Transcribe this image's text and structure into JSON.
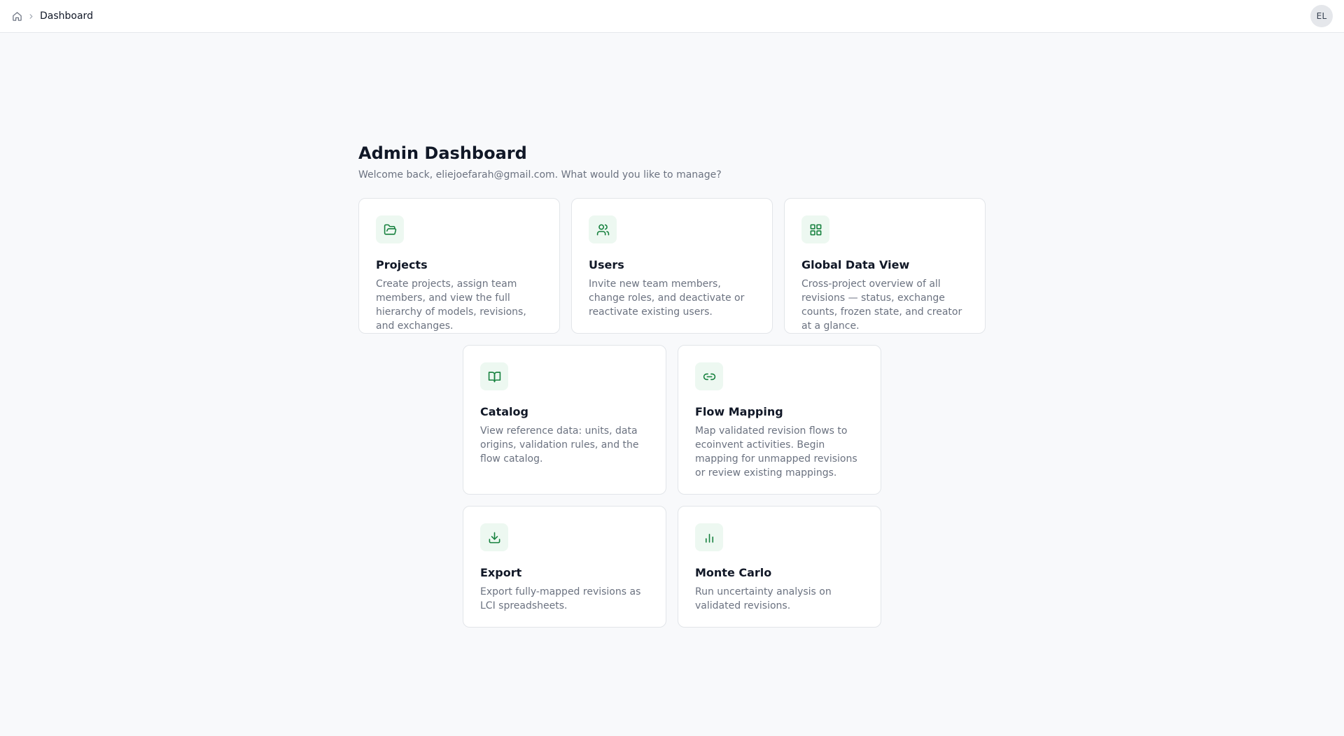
{
  "breadcrumb": {
    "home_icon": "home-icon",
    "current": "Dashboard"
  },
  "user": {
    "initials": "EL"
  },
  "header": {
    "title": "Admin Dashboard",
    "subtitle": "Welcome back, eliejoefarah@gmail.com. What would you like to manage?"
  },
  "colors": {
    "accent": "#15803d",
    "icon_bg": "#edf8f1",
    "page_bg": "#f8f9fb"
  },
  "cards": [
    {
      "icon": "folder-open-icon",
      "title": "Projects",
      "description": "Create projects, assign team members, and view the full hierarchy of models, revisions, and exchanges."
    },
    {
      "icon": "users-icon",
      "title": "Users",
      "description": "Invite new team members, change roles, and deactivate or reactivate existing users."
    },
    {
      "icon": "grid-icon",
      "title": "Global Data View",
      "description": "Cross-project overview of all revisions — status, exchange counts, frozen state, and creator at a glance."
    },
    {
      "icon": "book-open-icon",
      "title": "Catalog",
      "description": "View reference data: units, data origins, validation rules, and the flow catalog."
    },
    {
      "icon": "link-icon",
      "title": "Flow Mapping",
      "description": "Map validated revision flows to ecoinvent activities. Begin mapping for unmapped revisions or review existing mappings."
    },
    {
      "icon": "download-icon",
      "title": "Export",
      "description": "Export fully-mapped revisions as LCI spreadsheets."
    },
    {
      "icon": "bar-chart-icon",
      "title": "Monte Carlo",
      "description": "Run uncertainty analysis on validated revisions."
    }
  ]
}
